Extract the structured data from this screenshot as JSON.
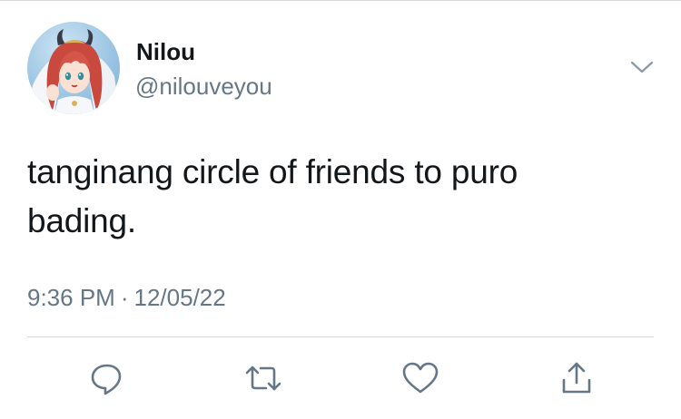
{
  "user": {
    "display_name": "Nilou",
    "handle": "@nilouveyou",
    "avatar_icon": "anime-character-avatar"
  },
  "tweet": {
    "lines": [
      "tanginang circle of friends to puro",
      "bading."
    ],
    "time": "9:36 PM",
    "separator": "·",
    "date": "12/05/22"
  },
  "actions": [
    {
      "name": "reply",
      "icon": "speech-bubble-icon"
    },
    {
      "name": "retweet",
      "icon": "retweet-arrows-icon"
    },
    {
      "name": "like",
      "icon": "heart-icon"
    },
    {
      "name": "share",
      "icon": "share-upload-icon"
    }
  ],
  "colors": {
    "text_primary": "#14171a",
    "text_secondary": "#657786",
    "icon": "#657786",
    "divider": "#d6d9dc"
  }
}
